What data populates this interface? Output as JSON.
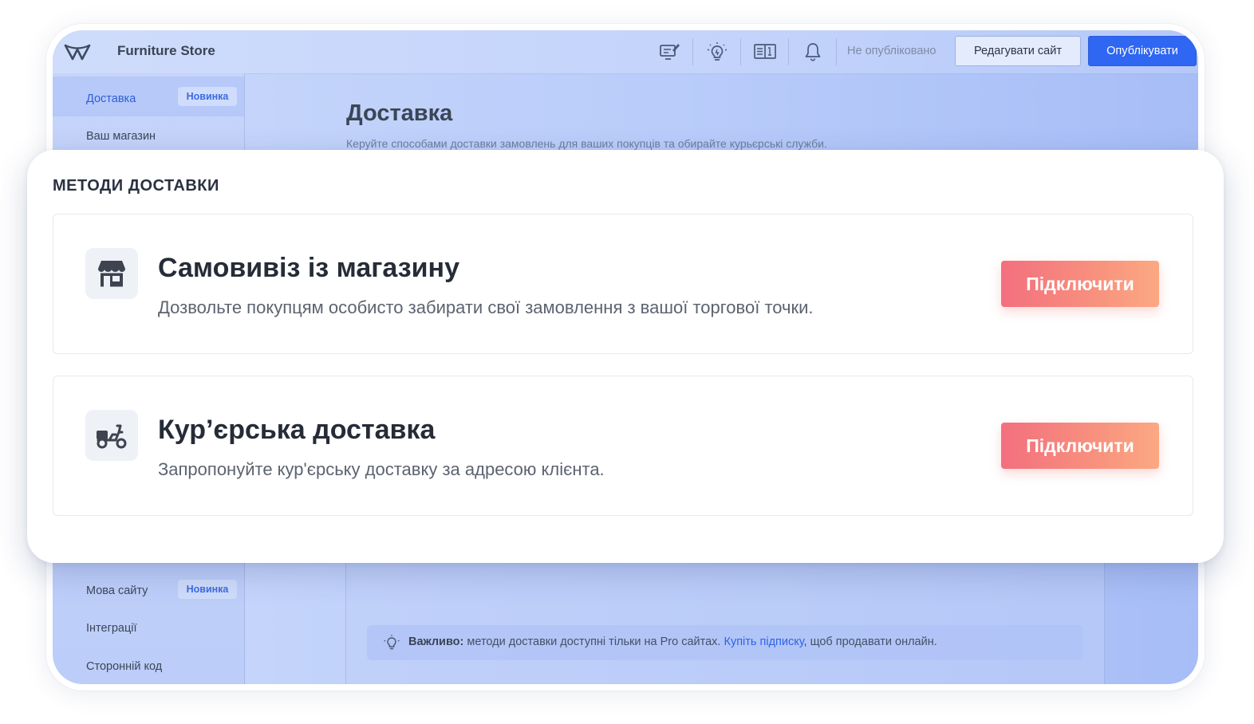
{
  "app": {
    "title": "Furniture Store",
    "status": "Не опубліковано",
    "edit_label": "Редагувати сайт",
    "publish_label": "Опублікувати"
  },
  "toolbar": {
    "icons": [
      "monitor-edit-icon",
      "lightbulb-icon",
      "book-icon",
      "bell-icon"
    ]
  },
  "sidebar": {
    "items": [
      {
        "label": "Доставка",
        "badge": "Новинка",
        "active": true
      },
      {
        "label": "Ваш магазин",
        "badge": ""
      },
      {
        "label": "Мова сайту",
        "badge": "Новинка"
      },
      {
        "label": "Інтеграції",
        "badge": ""
      },
      {
        "label": "Сторонній код",
        "badge": ""
      }
    ]
  },
  "page": {
    "title": "Доставка",
    "subtitle": "Керуйте способами доставки замовлень для ваших покупців та обирайте курьєрські служби."
  },
  "delivery_methods": {
    "section_title": "МЕТОДИ ДОСТАВКИ",
    "items": [
      {
        "icon": "store-icon",
        "title": "Самовивіз із магазину",
        "description": "Дозвольте покупцям особисто забирати свої замовлення з вашої торгової точки.",
        "button": "Підключити"
      },
      {
        "icon": "scooter-icon",
        "title": "Кур’єрська доставка",
        "description": "Запропонуйте кур'єрську доставку за адресою клієнта.",
        "button": "Підключити"
      }
    ]
  },
  "notice": {
    "label": "Важливо:",
    "text_before": " методи доставки доступні тільки на Pro сайтах. ",
    "link": "Купіть підписку",
    "text_after": ", щоб продавати онлайн."
  },
  "colors": {
    "accent": "#2f66f2",
    "connect_button_start": "#f36f7e",
    "connect_button_end": "#fba982",
    "badge_text": "#3d6be0"
  }
}
